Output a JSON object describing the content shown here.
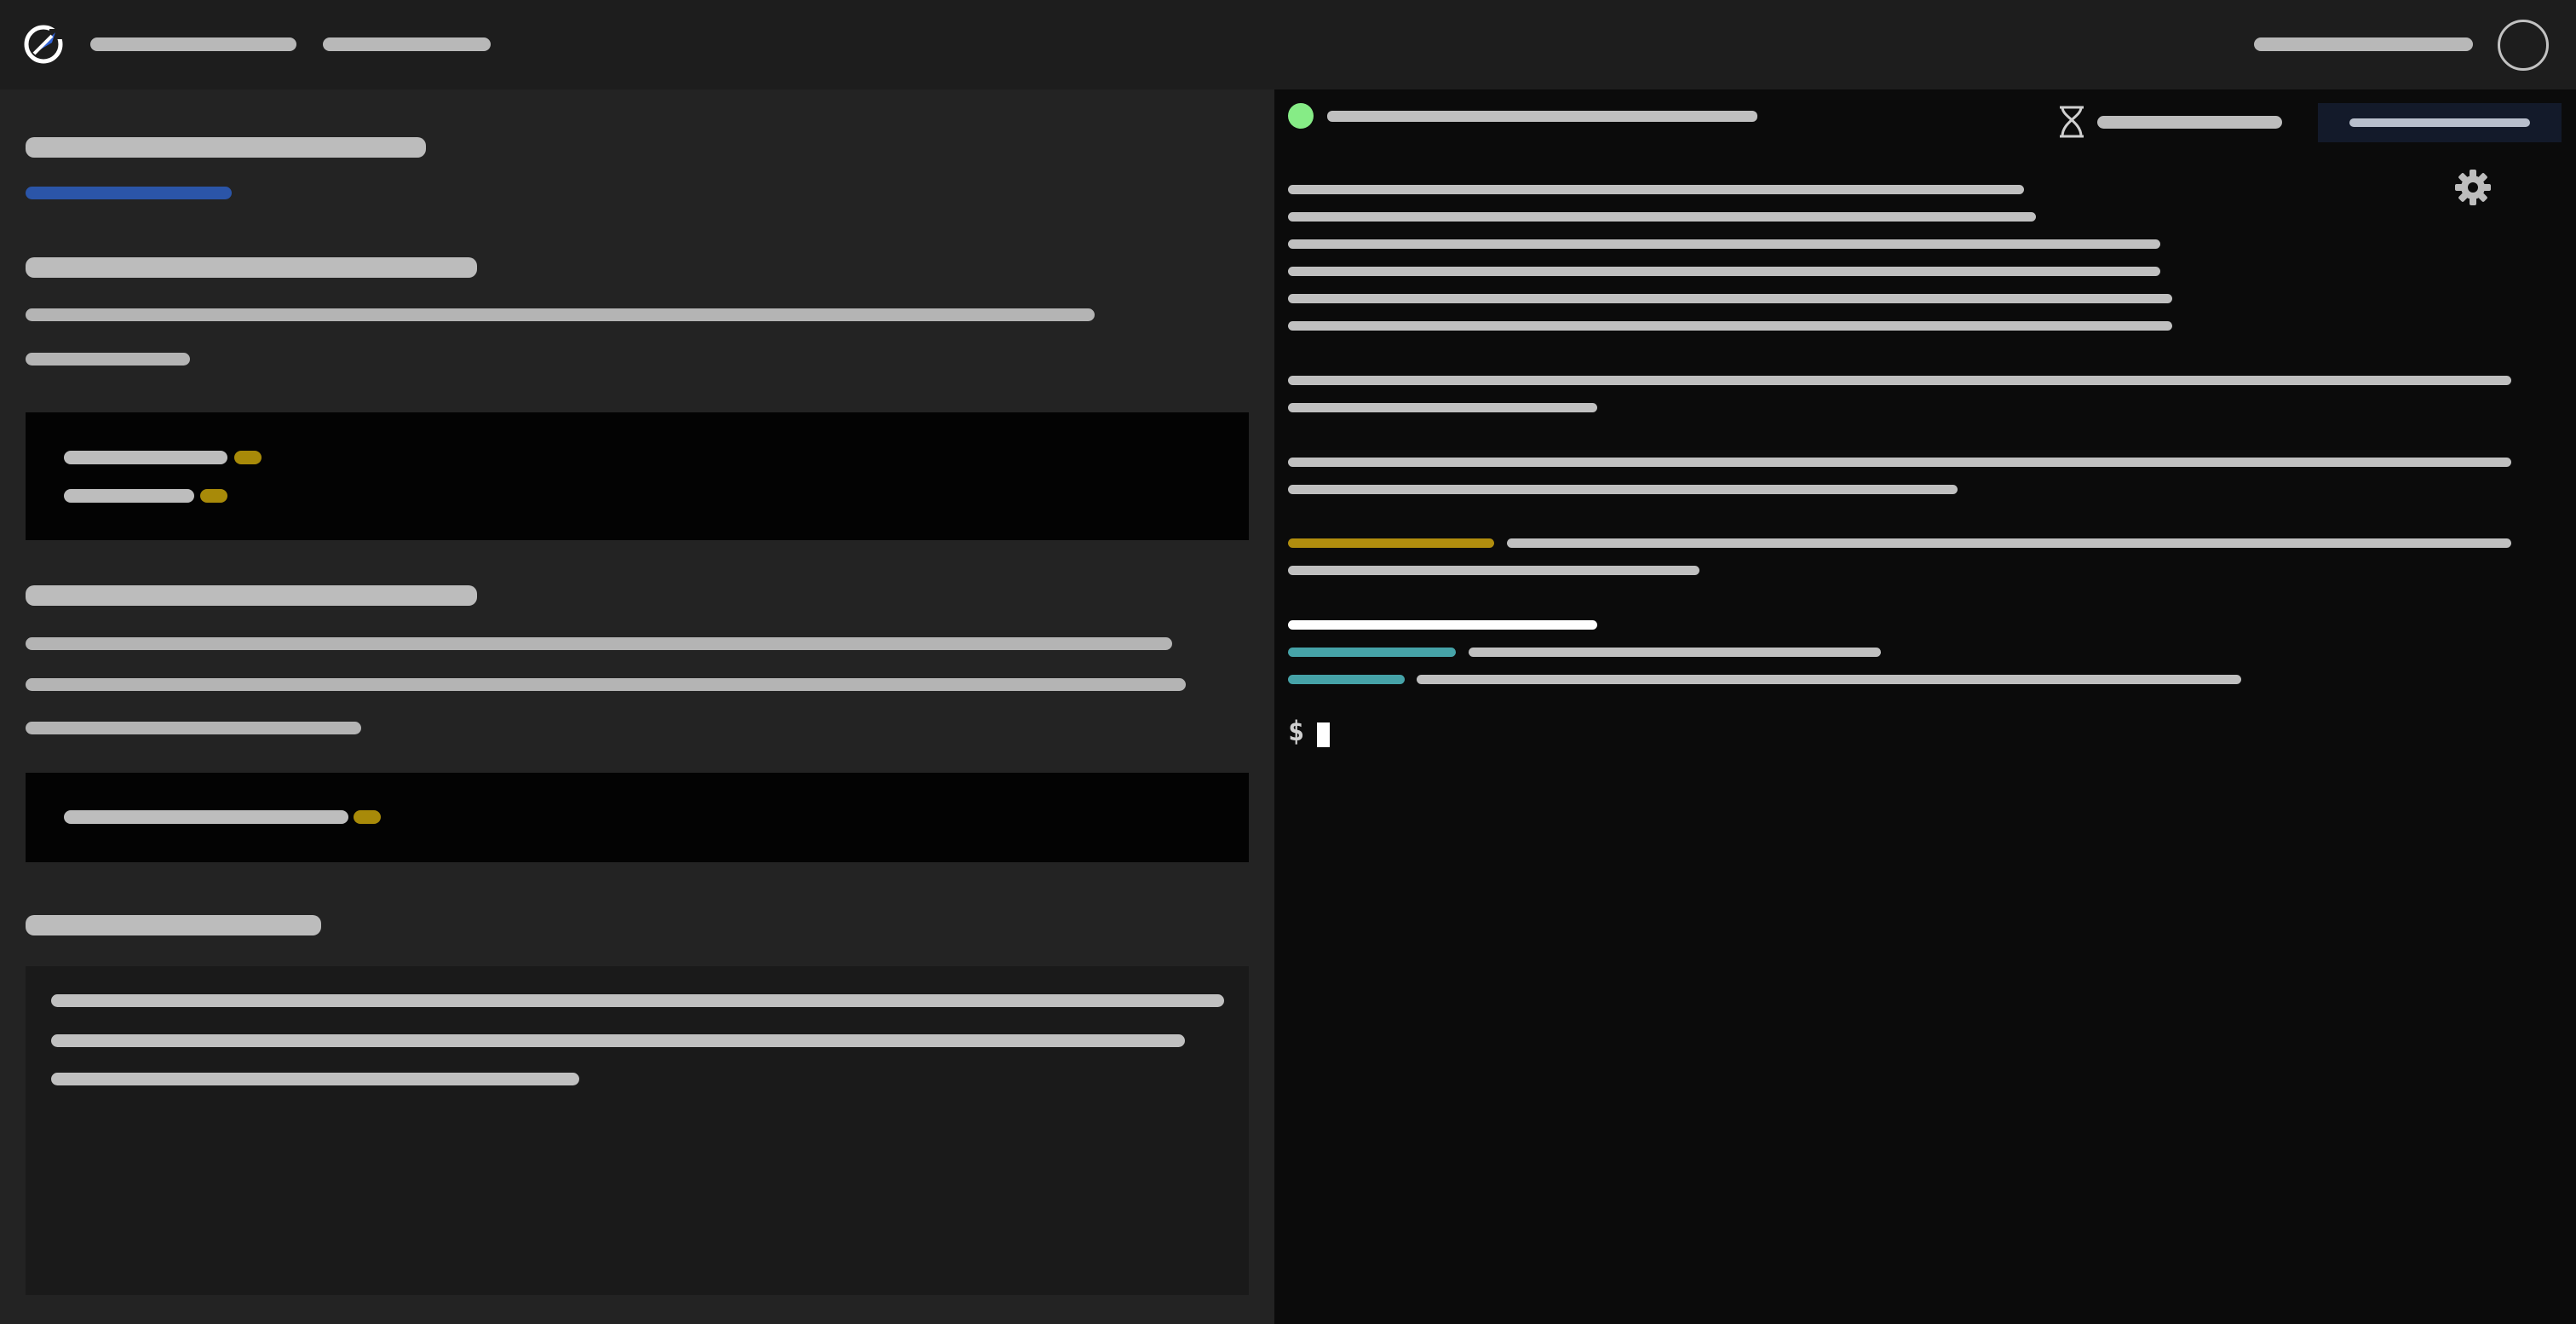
{
  "topbar": {
    "logo_icon": "logo-icon",
    "nav_count": 2,
    "avatar_icon": "avatar-icon"
  },
  "terminal": {
    "prompt_symbol": "$",
    "status_color": "#86ec86",
    "timer_icon": "hourglass-icon",
    "settings_icon": "gear-icon"
  },
  "colors": {
    "accent_link": "#2b55a8",
    "highlight_chip": "#a88a09",
    "terminal_bg": "#0b0b0b",
    "panel_bg": "#232323"
  }
}
